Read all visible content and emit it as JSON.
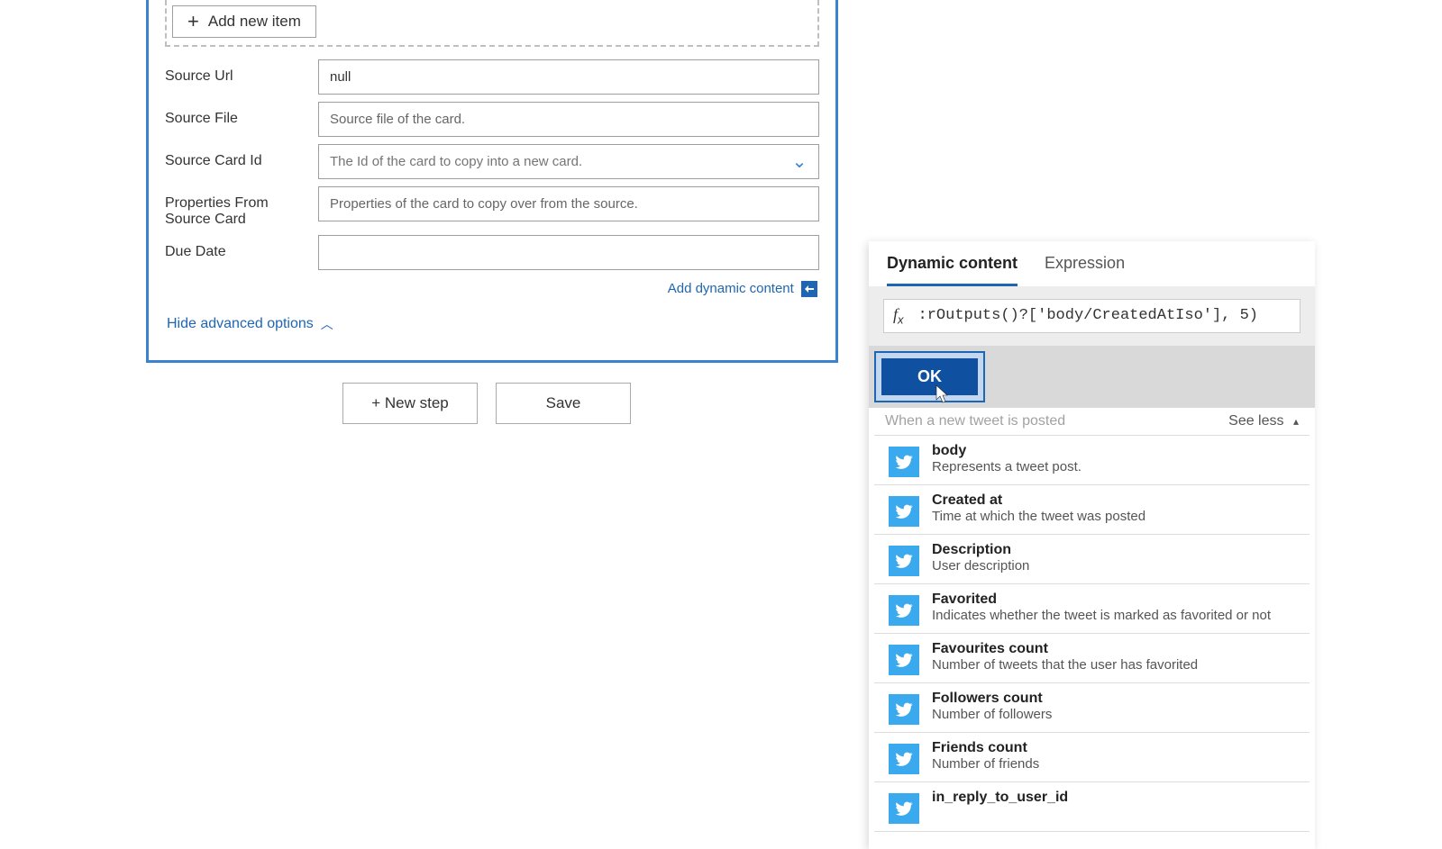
{
  "card": {
    "addItemLabel": "Add new item",
    "fields": {
      "sourceUrl": {
        "label": "Source Url",
        "value": "null"
      },
      "sourceFile": {
        "label": "Source File",
        "placeholder": "Source file of the card."
      },
      "sourceCardId": {
        "label": "Source Card Id",
        "placeholder": "The Id of the card to copy into a new card."
      },
      "propsFromSource": {
        "label": "Properties From Source Card",
        "placeholder": "Properties of the card to copy over from the source."
      },
      "dueDate": {
        "label": "Due Date",
        "value": ""
      }
    },
    "dynamicLink": "Add dynamic content",
    "hideAdvanced": "Hide advanced options"
  },
  "bottom": {
    "newStep": "+ New step",
    "save": "Save"
  },
  "popup": {
    "tabs": {
      "dynamic": "Dynamic content",
      "expression": "Expression"
    },
    "fx": ":rOutputs()?['body/CreatedAtIso'], 5)",
    "ok": "OK",
    "groupTitle": "When a new tweet is posted",
    "seeLess": "See less",
    "items": [
      {
        "title": "body",
        "desc": "Represents a tweet post."
      },
      {
        "title": "Created at",
        "desc": "Time at which the tweet was posted"
      },
      {
        "title": "Description",
        "desc": "User description"
      },
      {
        "title": "Favorited",
        "desc": "Indicates whether the tweet is marked as favorited or not"
      },
      {
        "title": "Favourites count",
        "desc": "Number of tweets that the user has favorited"
      },
      {
        "title": "Followers count",
        "desc": "Number of followers"
      },
      {
        "title": "Friends count",
        "desc": "Number of friends"
      },
      {
        "title": "in_reply_to_user_id",
        "desc": ""
      }
    ]
  }
}
